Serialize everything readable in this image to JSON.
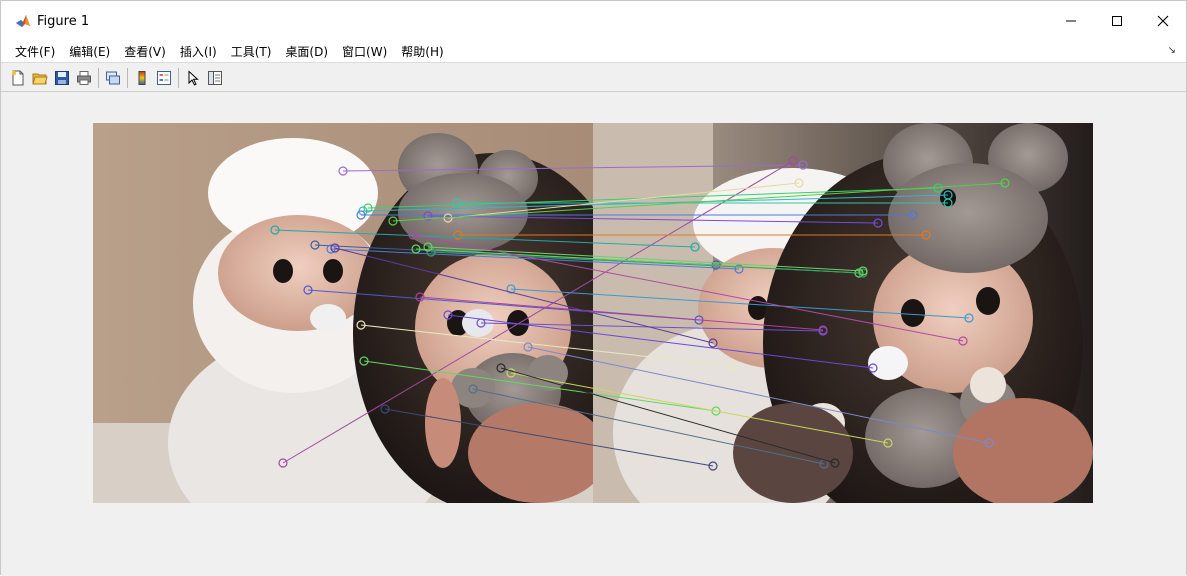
{
  "window": {
    "title": "Figure 1",
    "controls": [
      "minimize-icon",
      "maximize-icon",
      "close-icon"
    ]
  },
  "menu": {
    "items": [
      "文件(F)",
      "编辑(E)",
      "查看(V)",
      "插入(I)",
      "工具(T)",
      "桌面(D)",
      "窗口(W)",
      "帮助(H)"
    ],
    "overflow_glyph": "↘"
  },
  "toolbar": {
    "buttons": [
      "new-figure-icon",
      "open-file-icon",
      "save-icon",
      "print-icon",
      "link-plot-icon",
      "colorbar-icon",
      "legend-icon",
      "edit-plot-arrow-icon",
      "property-inspector-icon"
    ]
  },
  "figure": {
    "content": "two side-by-side photographs of plush dolls with feature-match lines drawn between them",
    "match_count": 30
  }
}
